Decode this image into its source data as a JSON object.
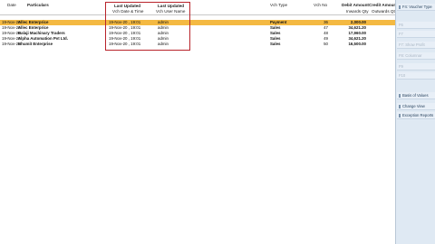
{
  "columns": {
    "date": "Date",
    "particulars": "Particulars",
    "last_updated_1": "Last Updated",
    "vch_date_time": "Vch Date & Time",
    "last_updated_2": "Last Updated",
    "vch_user_name": "Vch User Name",
    "vch_type": "Vch Type",
    "vch_no": "Vch No",
    "debit_amount": "Debit Amount",
    "inwards_qty": "Inwards Qty",
    "credit_amount": "Credit Amount",
    "outwards_qty": "Outwards Qty"
  },
  "rows": [
    {
      "date": "19-Nov-20",
      "particulars": "Allec Enterprice",
      "datetime": "19-Nov-20 ,  19:01",
      "user": "admin",
      "type": "Payment",
      "no": "36",
      "debit": "2,000.00",
      "selected": true
    },
    {
      "date": "19-Nov-20",
      "particulars": "Allec Enterprice",
      "datetime": "19-Nov-20 ,  19:01",
      "user": "admin",
      "type": "Sales",
      "no": "47",
      "debit": "34,621.20",
      "selected": false
    },
    {
      "date": "19-Nov-20",
      "particulars": "Balaji Machinary Traders",
      "datetime": "19-Nov-20 ,  19:01",
      "user": "admin",
      "type": "Sales",
      "no": "48",
      "debit": "17,960.00",
      "selected": false
    },
    {
      "date": "19-Nov-20",
      "particulars": "Alpha Automation Pvt Ltd.",
      "datetime": "19-Nov-20 ,  19:01",
      "user": "admin",
      "type": "Sales",
      "no": "49",
      "debit": "34,621.20",
      "selected": false
    },
    {
      "date": "19-Nov-25",
      "particulars": "Bhumit Enterprise",
      "datetime": "19-Nov-20 ,  19:01",
      "user": "admin",
      "type": "Sales",
      "no": "50",
      "debit": "16,500.00",
      "selected": false
    }
  ],
  "sidebar": {
    "voucher_type": "F4: Voucher Type",
    "f6": "F6",
    "f7": "F7",
    "show_profit": "F7: Show Profit",
    "f8_columns": "F8: Columnar",
    "f9": "F9",
    "f10": "F10",
    "basis_of_values": "Basis of Values",
    "change_view": "Change View",
    "exception_reports": "Exception Reports"
  }
}
